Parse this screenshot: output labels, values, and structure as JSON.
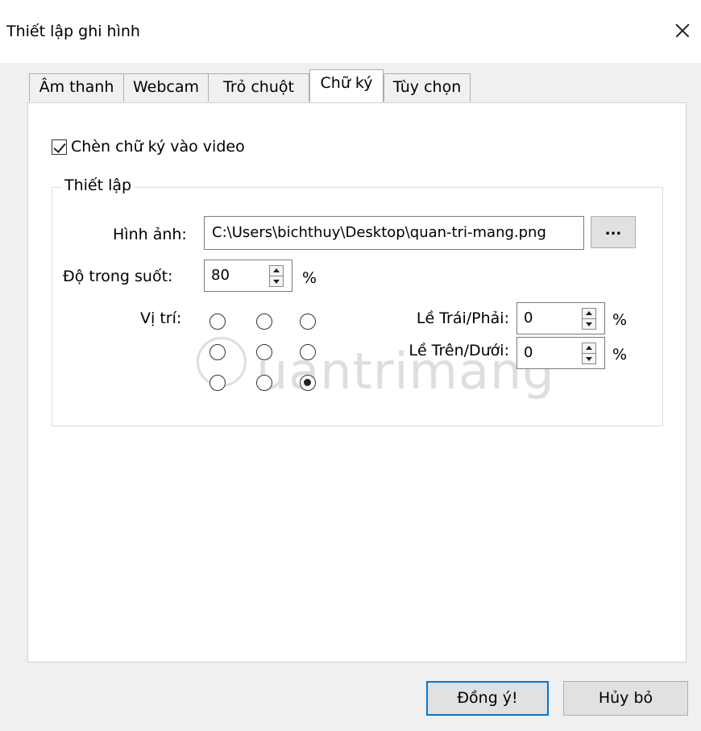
{
  "window": {
    "title": "Thiết lập ghi hình"
  },
  "tabs": [
    "Âm thanh",
    "Webcam",
    "Trỏ chuột",
    "Chữ ký",
    "Tùy chọn"
  ],
  "active_tab": "Chữ ký",
  "signature": {
    "embed_checkbox_label": "Chèn chữ ký vào video",
    "embed_checked": true,
    "group_title": "Thiết lập",
    "image_label": "Hình ảnh:",
    "image_path": "C:\\Users\\bichthuy\\Desktop\\quan-tri-mang.png",
    "browse_label": "...",
    "opacity_label": "Độ trong suốt:",
    "opacity_value": "80",
    "opacity_unit": "%",
    "position_label": "Vị trí:",
    "position_selected": "bottom-right",
    "margin_lr_label": "Lề Trái/Phải:",
    "margin_lr_value": "0",
    "margin_lr_unit": "%",
    "margin_tb_label": "Lề Trên/Dưới:",
    "margin_tb_value": "0",
    "margin_tb_unit": "%"
  },
  "watermark_text": "uantrimang",
  "buttons": {
    "ok": "Đồng ý!",
    "cancel": "Hủy bỏ"
  }
}
